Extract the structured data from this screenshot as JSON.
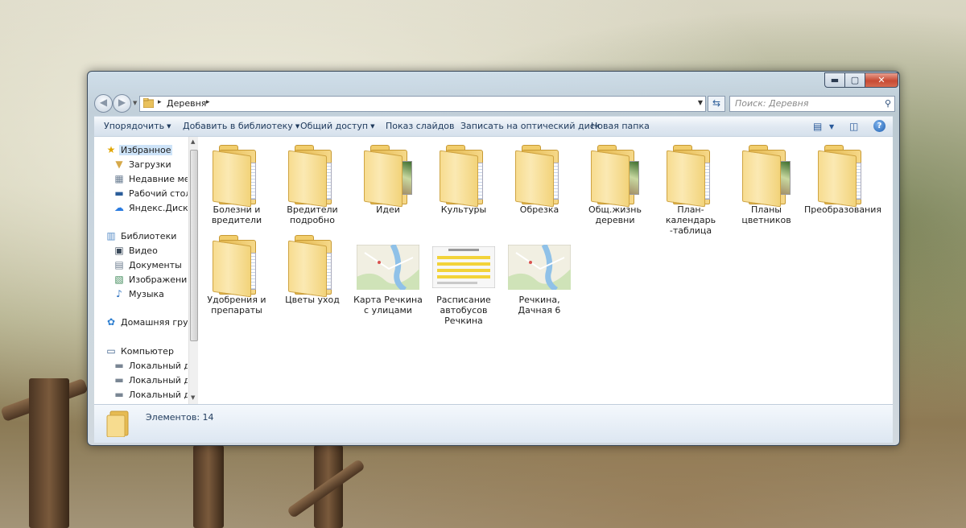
{
  "window": {
    "controls": {
      "minimize": "▬",
      "maximize": "▢",
      "close": "✕"
    }
  },
  "address": {
    "path": "Деревня",
    "separator": "▸"
  },
  "search": {
    "placeholder": "Поиск: Деревня"
  },
  "toolbar": {
    "organize": "Упорядочить",
    "add_to_library": "Добавить в библиотеку",
    "share": "Общий доступ",
    "slideshow": "Показ слайдов",
    "burn": "Записать на оптический диск",
    "new_folder": "Новая папка",
    "help": "?"
  },
  "sidebar": {
    "favorites": {
      "label": "Избранное",
      "items": [
        "Загрузки",
        "Недавние места",
        "Рабочий стол",
        "Яндекс.Диск"
      ]
    },
    "libraries": {
      "label": "Библиотеки",
      "items": [
        "Видео",
        "Документы",
        "Изображения",
        "Музыка"
      ]
    },
    "homegroup": "Домашняя группа",
    "computer": {
      "label": "Компьютер",
      "items": [
        "Локальный диск",
        "Локальный диск",
        "Локальный диск"
      ]
    }
  },
  "items": [
    {
      "name": "Болезни и вредители",
      "type": "folder"
    },
    {
      "name": "Вредители подробно",
      "type": "folder"
    },
    {
      "name": "Идеи",
      "type": "folder-photo"
    },
    {
      "name": "Культуры",
      "type": "folder"
    },
    {
      "name": "Обрезка",
      "type": "folder"
    },
    {
      "name": "Общ.жизнь деревни",
      "type": "folder-photo"
    },
    {
      "name": "План-календарь -таблица",
      "type": "folder"
    },
    {
      "name": "Планы цветников",
      "type": "folder-photo"
    },
    {
      "name": "Преобразования",
      "type": "folder"
    },
    {
      "name": "Удобрения и препараты",
      "type": "folder"
    },
    {
      "name": "Цветы уход",
      "type": "folder"
    },
    {
      "name": "Карта Речкина с улицами",
      "type": "map"
    },
    {
      "name": "Расписание автобусов Речкина",
      "type": "schedule"
    },
    {
      "name": "Речкина, Дачная 6",
      "type": "map"
    }
  ],
  "status": {
    "count_text": "Элементов: 14"
  },
  "colors": {
    "accent": "#1e395b",
    "selection": "#cde3f8",
    "close": "#c74a33"
  }
}
